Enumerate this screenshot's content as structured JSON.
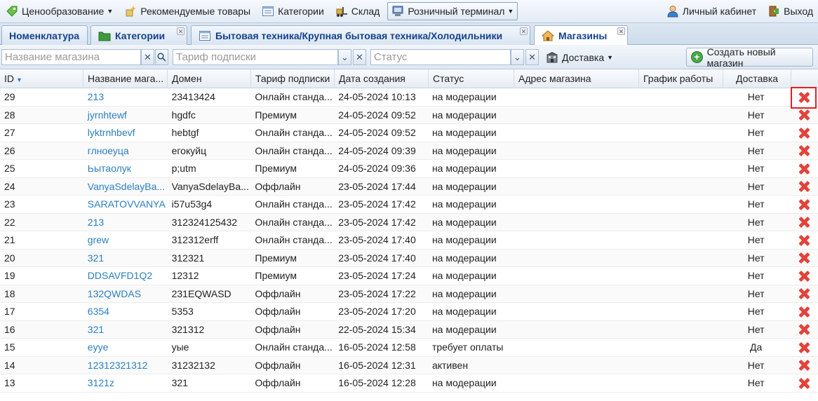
{
  "toolbar": {
    "pricing": "Ценообразование",
    "recommended": "Рекомендуемые товары",
    "categories": "Категории",
    "warehouse": "Склад",
    "pos": "Розничный терминал",
    "account": "Личный кабинет",
    "logout": "Выход"
  },
  "tabs": [
    {
      "label": "Номенклатура"
    },
    {
      "label": "Категории"
    },
    {
      "label": "Бытовая техника/Крупная бытовая техника/Холодильники"
    },
    {
      "label": "Магазины"
    }
  ],
  "filters": {
    "store_name_placeholder": "Название магазина",
    "tariff_placeholder": "Тариф подписки",
    "status_placeholder": "Статус",
    "delivery_label": "Доставка",
    "create_button": "Создать новый магазин"
  },
  "columns": [
    "ID",
    "Название мага...",
    "Домен",
    "Тариф подписки",
    "Дата создания",
    "Статус",
    "Адрес магазина",
    "График работы",
    "Доставка"
  ],
  "rows": [
    {
      "id": "29",
      "name": "213",
      "domain": "23413424",
      "tariff": "Онлайн станда...",
      "date": "24-05-2024 10:13",
      "status": "на модерации",
      "address": "",
      "schedule": "",
      "delivery": "Нет"
    },
    {
      "id": "28",
      "name": "jyrnhtewf",
      "domain": "hgdfc",
      "tariff": "Премиум",
      "date": "24-05-2024 09:52",
      "status": "на модерации",
      "address": "",
      "schedule": "",
      "delivery": "Нет"
    },
    {
      "id": "27",
      "name": "lyktrnhbevf",
      "domain": "hebtgf",
      "tariff": "Онлайн станда...",
      "date": "24-05-2024 09:52",
      "status": "на модерации",
      "address": "",
      "schedule": "",
      "delivery": "Нет"
    },
    {
      "id": "26",
      "name": "глноеуца",
      "domain": "егокуйц",
      "tariff": "Онлайн станда...",
      "date": "24-05-2024 09:39",
      "status": "на модерации",
      "address": "",
      "schedule": "",
      "delivery": "Нет"
    },
    {
      "id": "25",
      "name": "Ьытаолук",
      "domain": "p;utm",
      "tariff": "Премиум",
      "date": "24-05-2024 09:36",
      "status": "на модерации",
      "address": "",
      "schedule": "",
      "delivery": "Нет"
    },
    {
      "id": "24",
      "name": "VanyaSdelayBa...",
      "domain": "VanyaSdelayBa...",
      "tariff": "Оффлайн",
      "date": "23-05-2024 17:44",
      "status": "на модерации",
      "address": "",
      "schedule": "",
      "delivery": "Нет"
    },
    {
      "id": "23",
      "name": "SARATOVVANYA",
      "domain": "i57u53g4",
      "tariff": "Онлайн станда...",
      "date": "23-05-2024 17:42",
      "status": "на модерации",
      "address": "",
      "schedule": "",
      "delivery": "Нет"
    },
    {
      "id": "22",
      "name": "213",
      "domain": "312324125432",
      "tariff": "Онлайн станда...",
      "date": "23-05-2024 17:42",
      "status": "на модерации",
      "address": "",
      "schedule": "",
      "delivery": "Нет"
    },
    {
      "id": "21",
      "name": "grew",
      "domain": "312312erff",
      "tariff": "Онлайн станда...",
      "date": "23-05-2024 17:40",
      "status": "на модерации",
      "address": "",
      "schedule": "",
      "delivery": "Нет"
    },
    {
      "id": "20",
      "name": "321",
      "domain": "312321",
      "tariff": "Премиум",
      "date": "23-05-2024 17:40",
      "status": "на модерации",
      "address": "",
      "schedule": "",
      "delivery": "Нет"
    },
    {
      "id": "19",
      "name": "DDSAVFD1Q2",
      "domain": "12312",
      "tariff": "Премиум",
      "date": "23-05-2024 17:24",
      "status": "на модерации",
      "address": "",
      "schedule": "",
      "delivery": "Нет"
    },
    {
      "id": "18",
      "name": "132QWDAS",
      "domain": "231EQWASD",
      "tariff": "Оффлайн",
      "date": "23-05-2024 17:22",
      "status": "на модерации",
      "address": "",
      "schedule": "",
      "delivery": "Нет"
    },
    {
      "id": "17",
      "name": "6354",
      "domain": "5353",
      "tariff": "Оффлайн",
      "date": "23-05-2024 17:20",
      "status": "на модерации",
      "address": "",
      "schedule": "",
      "delivery": "Нет"
    },
    {
      "id": "16",
      "name": "321",
      "domain": "321312",
      "tariff": "Оффлайн",
      "date": "22-05-2024 15:34",
      "status": "на модерации",
      "address": "",
      "schedule": "",
      "delivery": "Нет"
    },
    {
      "id": "15",
      "name": "eyye",
      "domain": "уые",
      "tariff": "Онлайн станда...",
      "date": "16-05-2024 12:58",
      "status": "требует оплаты",
      "address": "",
      "schedule": "",
      "delivery": "Да"
    },
    {
      "id": "14",
      "name": "12312321312",
      "domain": "31232132",
      "tariff": "Оффлайн",
      "date": "16-05-2024 12:31",
      "status": "активен",
      "address": "",
      "schedule": "",
      "delivery": "Нет"
    },
    {
      "id": "13",
      "name": "3121z",
      "domain": "321",
      "tariff": "Оффлайн",
      "date": "16-05-2024 12:28",
      "status": "на модерации",
      "address": "",
      "schedule": "",
      "delivery": "Нет"
    }
  ],
  "colors": {
    "link": "#2a7fc0",
    "delete": "#e2433b",
    "highlight": "#e02020"
  },
  "icons": {
    "delete": "delete-x-icon",
    "create": "plus-circle-icon",
    "search": "search-icon",
    "clear": "clear-icon",
    "dropdown": "chevron-down-icon"
  }
}
